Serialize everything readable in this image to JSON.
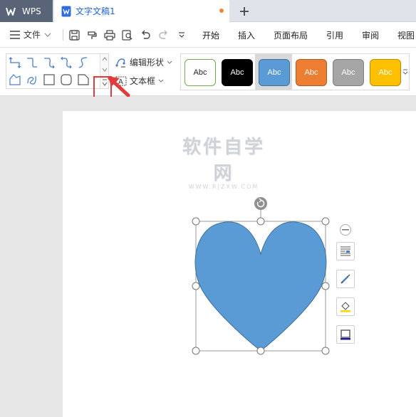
{
  "titlebar": {
    "app_tab": "WPS",
    "doc_tab": "文字文稿1",
    "new_tab_icon": "plus-icon"
  },
  "menubar": {
    "file_label": "文件",
    "tabs": [
      "开始",
      "插入",
      "页面布局",
      "引用",
      "审阅",
      "视图"
    ]
  },
  "ribbon": {
    "edit_shape_label": "编辑形状",
    "text_box_label": "文本框",
    "styles": [
      {
        "label": "Abc",
        "fill": "#ffffff",
        "border": "#70ad47",
        "text": "#222222"
      },
      {
        "label": "Abc",
        "fill": "#000000",
        "border": "#000000",
        "text": "#ffffff"
      },
      {
        "label": "Abc",
        "fill": "#5b9bd5",
        "border": "#41719c",
        "text": "#ffffff"
      },
      {
        "label": "Abc",
        "fill": "#ed7d31",
        "border": "#ae5a21",
        "text": "#ffffff"
      },
      {
        "label": "Abc",
        "fill": "#a5a5a5",
        "border": "#7f7f7f",
        "text": "#ffffff"
      },
      {
        "label": "Abc",
        "fill": "#ffc000",
        "border": "#bc8c00",
        "text": "#ffffff"
      }
    ]
  },
  "document": {
    "watermark_title": "软件自学网",
    "watermark_url": "WWW.RJZXW.COM",
    "heart_fill": "#5b9bd5",
    "heart_stroke": "#41719c",
    "accent_red": "#e23b3b"
  }
}
